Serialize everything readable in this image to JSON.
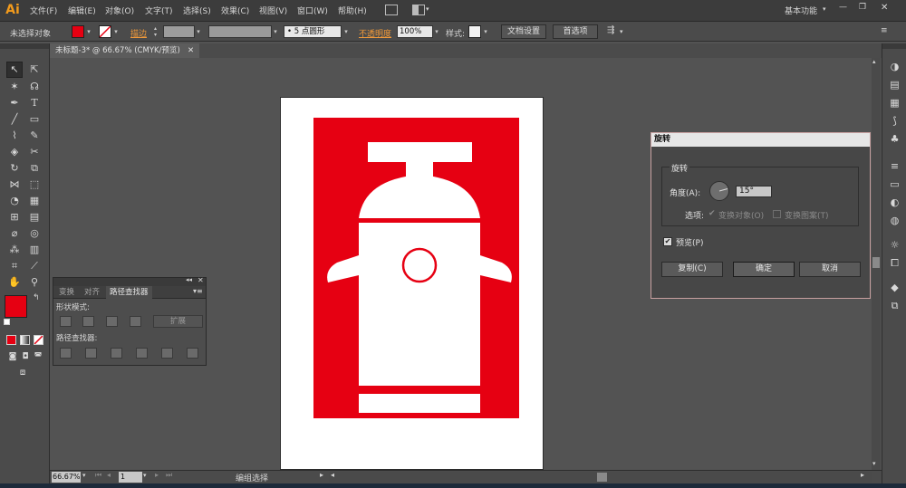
{
  "app": {
    "logo": "Ai"
  },
  "menus": [
    "文件(F)",
    "编辑(E)",
    "对象(O)",
    "文字(T)",
    "选择(S)",
    "效果(C)",
    "视图(V)",
    "窗口(W)",
    "帮助(H)"
  ],
  "workspace": {
    "label": "基本功能",
    "minimize": "—",
    "maximize": "❐",
    "close": "✕"
  },
  "control_bar": {
    "selection_status": "未选择对象",
    "fill_color": "#e60012",
    "stroke_label": "描边",
    "brush_label": "5 点圆形",
    "opacity_label": "不透明度",
    "opacity_value": "100%",
    "style_label": "样式",
    "doc_setup_button": "文档设置",
    "preferences_button": "首选项"
  },
  "document_tab": {
    "title": "未标题-3* @ 66.67% (CMYK/预览)",
    "close": "✕"
  },
  "artwork": {
    "background_color": "#e60012",
    "figure_color": "#ffffff"
  },
  "pathfinder_panel": {
    "tabs": [
      "变换",
      "对齐",
      "路径查找器"
    ],
    "shape_modes_label": "形状模式:",
    "expand_button": "扩展",
    "pathfinders_label": "路径查找器:"
  },
  "rotate_dialog": {
    "title": "旋转",
    "group_label": "旋转",
    "angle_label": "角度(A):",
    "angle_value": "15°",
    "options_label": "选项:",
    "transform_objects": "变换对象(O)",
    "transform_patterns": "变换图案(T)",
    "preview_label": "预览(P)",
    "preview_checked": true,
    "copy_button": "复制(C)",
    "ok_button": "确定",
    "cancel_button": "取消"
  },
  "status_bar": {
    "zoom": "66.67%",
    "artboard": "1",
    "status_text": "编组选择"
  }
}
